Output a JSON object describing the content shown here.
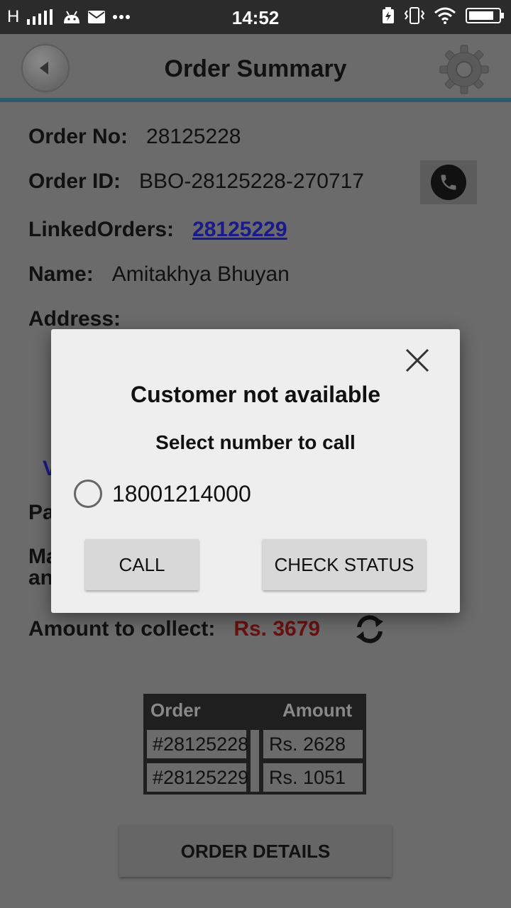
{
  "status_bar": {
    "signal_text": "H",
    "time": "14:52",
    "icons": [
      "signal-icon",
      "android-icon",
      "mail-icon",
      "more-dots-icon",
      "battery-saver-icon",
      "vibrate-icon",
      "wifi-icon",
      "battery-icon"
    ]
  },
  "toolbar": {
    "title": "Order Summary",
    "back_icon": "back-arrow-icon",
    "settings_icon": "gear-icon"
  },
  "order": {
    "order_no_label": "Order No:",
    "order_no": "28125228",
    "order_id_label": "Order ID:",
    "order_id": "BBO-28125228-270717",
    "linked_label": "LinkedOrders:",
    "linked_value": "28125229",
    "name_label": "Name:",
    "name_value": "Amitakhya Bhuyan",
    "address_label": "Address:",
    "partial_link": "V",
    "partial_pa": "Pa",
    "partial_ma": "Ma",
    "partial_an": "an",
    "amount_label": "Amount to collect:",
    "amount_value": "Rs. 3679"
  },
  "table": {
    "headers": [
      "Order",
      "Amount"
    ],
    "rows": [
      {
        "order": "#28125228",
        "amount": "Rs. 2628"
      },
      {
        "order": "#28125229",
        "amount": "Rs. 1051"
      }
    ]
  },
  "order_details_label": "ORDER DETAILS",
  "dialog": {
    "title": "Customer not available",
    "subtitle": "Select number to call",
    "phone_number": "18001214000",
    "call_label": "CALL",
    "check_status_label": "CHECK STATUS"
  }
}
